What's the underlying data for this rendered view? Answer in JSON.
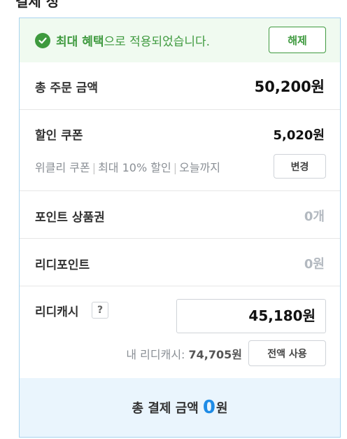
{
  "header_partial": "결제 정",
  "benefit": {
    "highlight": "최대 혜택",
    "rest": "으로 적용되었습니다.",
    "release_label": "해제"
  },
  "total_order": {
    "label": "총 주문 금액",
    "value": "50,200원"
  },
  "coupon": {
    "label": "할인 쿠폰",
    "value": "5,020원",
    "detail_parts": [
      "위클리 쿠폰",
      "최대 10% 할인",
      "오늘까지"
    ],
    "separator": "|",
    "change_label": "변경"
  },
  "point_voucher": {
    "label": "포인트 상품권",
    "value": "0개"
  },
  "ridi_point": {
    "label": "리디포인트",
    "value": "0원"
  },
  "ridi_cash": {
    "label": "리디캐시",
    "help": "?",
    "input_value": "45,180원",
    "my_cash_label": "내 리디캐시: ",
    "my_cash_value": "74,705원",
    "use_all_label": "전액 사용"
  },
  "total_payment": {
    "label": "총 결제 금액",
    "amount": "0",
    "unit": "원"
  },
  "colors": {
    "accent_blue": "#1f8ce6",
    "accent_green": "#3f9a3f",
    "footer_bg": "#eaf5fd"
  }
}
